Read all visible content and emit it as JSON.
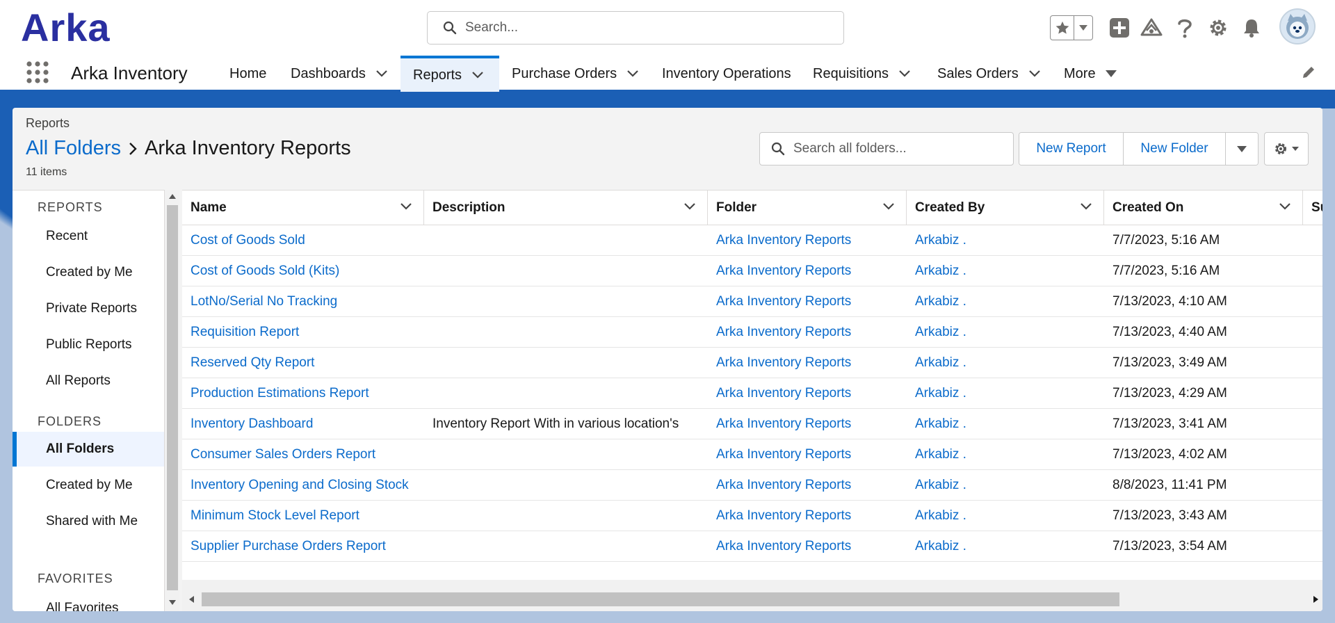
{
  "header": {
    "logo_text": "Arka",
    "search_placeholder": "Search..."
  },
  "nav": {
    "app_name": "Arka Inventory",
    "items": [
      {
        "label": "Home"
      },
      {
        "label": "Dashboards"
      },
      {
        "label": "Reports"
      },
      {
        "label": "Purchase Orders"
      },
      {
        "label": "Inventory Operations"
      },
      {
        "label": "Requisitions"
      },
      {
        "label": "Sales Orders"
      },
      {
        "label": "More"
      }
    ]
  },
  "page": {
    "object_label": "Reports",
    "breadcrumb_link": "All Folders",
    "title": "Arka Inventory Reports",
    "item_count": "11 items",
    "folder_search_placeholder": "Search all folders...",
    "new_report_label": "New Report",
    "new_folder_label": "New Folder"
  },
  "left_panel": {
    "reports_heading": "REPORTS",
    "report_items": [
      "Recent",
      "Created by Me",
      "Private Reports",
      "Public Reports",
      "All Reports"
    ],
    "folders_heading": "FOLDERS",
    "folder_items": [
      "All Folders",
      "Created by Me",
      "Shared with Me"
    ],
    "selected_folder": "All Folders",
    "favorites_heading": "FAVORITES",
    "favorites_partial": "All Favorites"
  },
  "table": {
    "columns": [
      "Name",
      "Description",
      "Folder",
      "Created By",
      "Created On",
      "Su"
    ],
    "rows": [
      {
        "name": "Cost of Goods Sold",
        "description": "",
        "folder": "Arka Inventory Reports",
        "created_by": "Arkabiz .",
        "created_on": "7/7/2023, 5:16 AM"
      },
      {
        "name": "Cost of Goods Sold (Kits)",
        "description": "",
        "folder": "Arka Inventory Reports",
        "created_by": "Arkabiz .",
        "created_on": "7/7/2023, 5:16 AM"
      },
      {
        "name": "LotNo/Serial No Tracking",
        "description": "",
        "folder": "Arka Inventory Reports",
        "created_by": "Arkabiz .",
        "created_on": "7/13/2023, 4:10 AM"
      },
      {
        "name": "Requisition Report",
        "description": "",
        "folder": "Arka Inventory Reports",
        "created_by": "Arkabiz .",
        "created_on": "7/13/2023, 4:40 AM"
      },
      {
        "name": "Reserved Qty Report",
        "description": "",
        "folder": "Arka Inventory Reports",
        "created_by": "Arkabiz .",
        "created_on": "7/13/2023, 3:49 AM"
      },
      {
        "name": "Production Estimations Report",
        "description": "",
        "folder": "Arka Inventory Reports",
        "created_by": "Arkabiz .",
        "created_on": "7/13/2023, 4:29 AM"
      },
      {
        "name": "Inventory Dashboard",
        "description": "Inventory Report With in various location's",
        "folder": "Arka Inventory Reports",
        "created_by": "Arkabiz .",
        "created_on": "7/13/2023, 3:41 AM"
      },
      {
        "name": "Consumer Sales Orders Report",
        "description": "",
        "folder": "Arka Inventory Reports",
        "created_by": "Arkabiz .",
        "created_on": "7/13/2023, 4:02 AM"
      },
      {
        "name": "Inventory Opening and Closing Stock",
        "description": "",
        "folder": "Arka Inventory Reports",
        "created_by": "Arkabiz .",
        "created_on": "8/8/2023, 11:41 PM"
      },
      {
        "name": "Minimum Stock Level Report",
        "description": "",
        "folder": "Arka Inventory Reports",
        "created_by": "Arkabiz .",
        "created_on": "7/13/2023, 3:43 AM"
      },
      {
        "name": "Supplier Purchase Orders Report",
        "description": "",
        "folder": "Arka Inventory Reports",
        "created_by": "Arkabiz .",
        "created_on": "7/13/2023, 3:54 AM"
      }
    ]
  },
  "icons": {
    "search": "search-icon",
    "favorites": "star-icon",
    "add": "plus-icon",
    "setup": "gear-icon",
    "help": "question-icon",
    "notifications": "bell-icon",
    "trailhead": "trailhead-icon",
    "app_launcher": "waffle-icon",
    "edit": "pencil-icon"
  },
  "colors": {
    "brand": "#0176d3",
    "link": "#0b6bcb",
    "logo": "#2a2fa0",
    "nav_border": "#1b5fb5"
  }
}
